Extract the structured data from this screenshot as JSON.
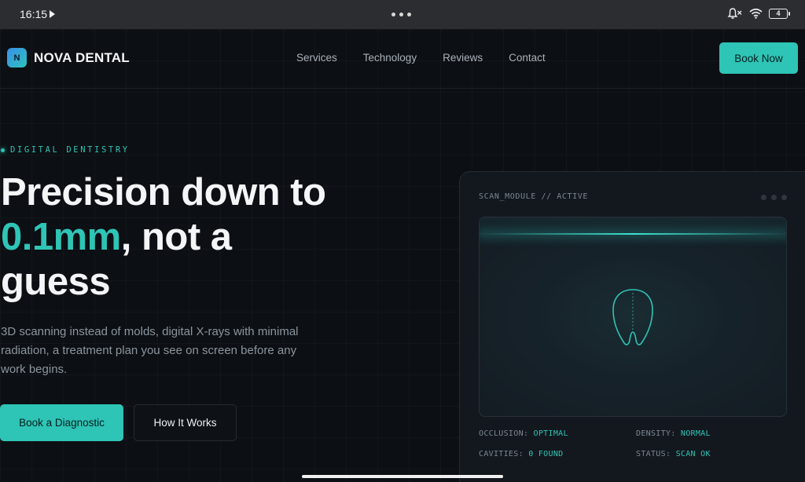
{
  "status_bar": {
    "time": "16:15",
    "battery": "4",
    "icons": [
      "play-icon",
      "bell-muted-icon",
      "wifi-icon",
      "battery-icon"
    ]
  },
  "nav": {
    "logo_mark": "N",
    "brand": "NOVA DENTAL",
    "links": [
      "Services",
      "Technology",
      "Reviews",
      "Contact"
    ],
    "cta": "Book Now"
  },
  "hero": {
    "eyebrow": "DIGITAL DENTISTRY",
    "headline_line1": "Precision down to",
    "headline_accent": "0.1mm",
    "headline_line2_rest": ", not a",
    "headline_line3": "guess",
    "subtext": "3D scanning instead of molds, digital X-rays with minimal radiation, a treatment plan you see on screen before any work begins.",
    "primary_cta": "Book a Diagnostic",
    "secondary_cta": "How It Works"
  },
  "scan_card": {
    "title": "SCAN_MODULE // ACTIVE",
    "metrics": [
      {
        "key": "OCCLUSION: ",
        "value": "OPTIMAL"
      },
      {
        "key": "DENSITY: ",
        "value": "NORMAL"
      },
      {
        "key": "CAVITIES: ",
        "value": "0 FOUND"
      },
      {
        "key": "STATUS: ",
        "value": "SCAN OK"
      }
    ]
  },
  "colors": {
    "accent": "#2ec4b6",
    "background": "#0c0f13",
    "card": "#13181e"
  }
}
